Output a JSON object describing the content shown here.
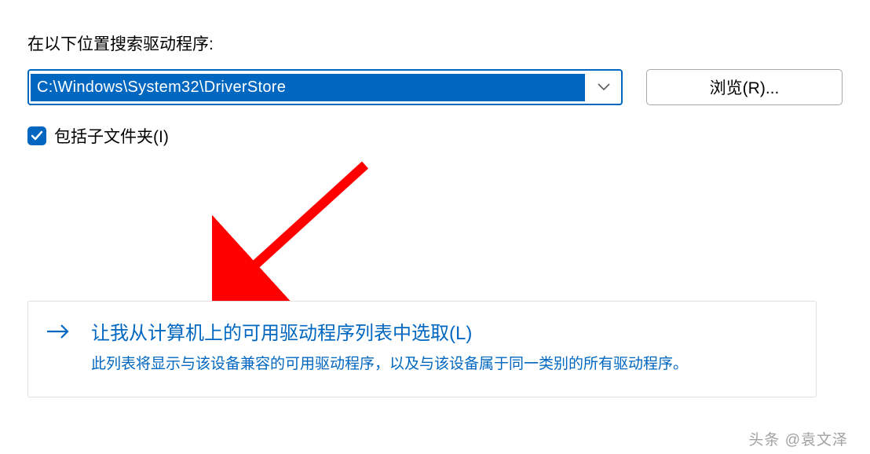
{
  "search": {
    "label": "在以下位置搜索驱动程序:",
    "path_value": "C:\\Windows\\System32\\DriverStore",
    "browse_label": "浏览(R)..."
  },
  "checkbox": {
    "label": "包括子文件夹(I)",
    "checked": true
  },
  "list_option": {
    "title": "让我从计算机上的可用驱动程序列表中选取(L)",
    "description": "此列表将显示与该设备兼容的可用驱动程序，以及与该设备属于同一类别的所有驱动程序。"
  },
  "watermark": "头条 @袁文泽",
  "colors": {
    "accent": "#0067c0",
    "arrow_red": "#ff0000"
  }
}
